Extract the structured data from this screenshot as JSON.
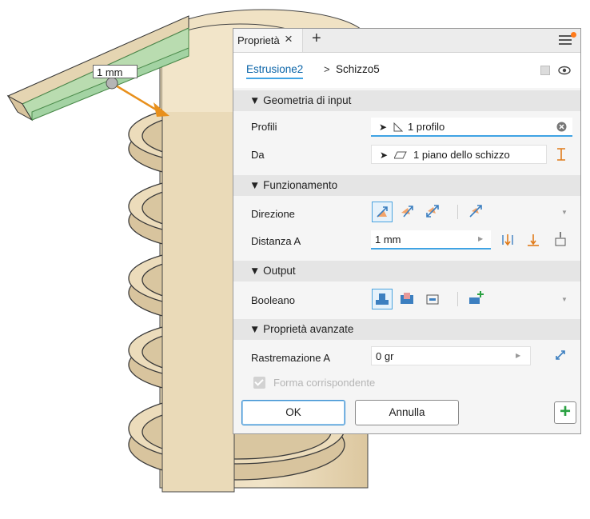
{
  "viewport": {
    "dimension_label": "1 mm",
    "colors": {
      "part_face": "#efe1c2",
      "part_shade": "#d8c49e",
      "part_edge": "#3a3a3a",
      "arrow": "#e8901c",
      "profile": "#a9d9a9"
    }
  },
  "panel": {
    "tab": {
      "label": "Proprietà",
      "close_icon": "close-icon",
      "add_icon": "plus-icon"
    },
    "menu_icon": "hamburger-menu-icon",
    "breadcrumb": {
      "active": "Estrusione2",
      "separator": ">",
      "item": "Schizzo5"
    },
    "sections": {
      "input": "▼ Geometria di input",
      "behavior": "▼ Funzionamento",
      "output": "▼ Output",
      "advanced": "▼ Proprietà avanzate"
    },
    "rows": {
      "profili": {
        "label": "Profili",
        "value": "1 profilo"
      },
      "da": {
        "label": "Da",
        "value": "1 piano dello schizzo"
      },
      "direzione": {
        "label": "Direzione"
      },
      "distanza": {
        "label": "Distanza A",
        "value": "1 mm"
      },
      "booleano": {
        "label": "Booleano"
      },
      "rastremazione": {
        "label": "Rastremazione A",
        "value": "0 gr"
      },
      "forma": {
        "label": "Forma corrispondente",
        "checked": true
      }
    },
    "buttons": {
      "ok": "OK",
      "cancel": "Annulla",
      "add": "+"
    },
    "accent_color": "#3fa3e4"
  }
}
